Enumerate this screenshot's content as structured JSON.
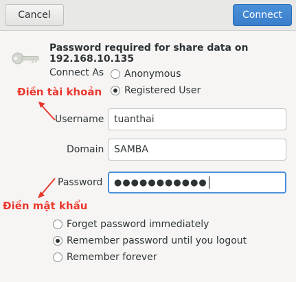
{
  "header": {
    "cancel_label": "Cancel",
    "connect_label": "Connect"
  },
  "prompt": "Password required for share data on 192.168.10.135",
  "connect_as": {
    "label": "Connect As",
    "options": [
      "Anonymous",
      "Registered User"
    ],
    "selected": "Registered User"
  },
  "fields": {
    "username_label": "Username",
    "username_value": "tuanthai",
    "domain_label": "Domain",
    "domain_value": "SAMBA",
    "password_label": "Password",
    "password_masked": "●●●●●●●●●●●"
  },
  "remember": {
    "options": [
      "Forget password immediately",
      "Remember password until you logout",
      "Remember forever"
    ],
    "selected": "Remember password until you logout"
  },
  "annotations": {
    "account": "Điền tài khoản",
    "password": "Điền mật khẩu"
  },
  "colors": {
    "annotation": "#e8382d",
    "accent": "#4a90d9"
  }
}
